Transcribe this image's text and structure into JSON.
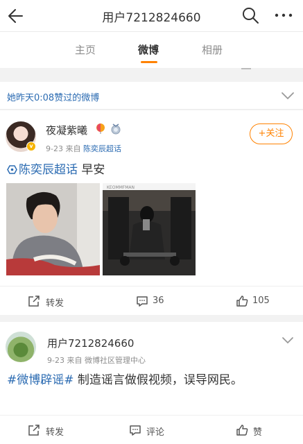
{
  "header": {
    "title": "用户7212824660"
  },
  "tabs": [
    {
      "label": "主页"
    },
    {
      "label": "微博"
    },
    {
      "label": "相册"
    }
  ],
  "likes_bar": {
    "text": "她昨天0:08赞过的微博"
  },
  "post1": {
    "author": "夜凝紫曦",
    "time": "9-23",
    "via_prefix": "来自",
    "source": "陈奕辰超话",
    "follow_label": "+关注",
    "topic": "陈奕辰超话",
    "text": "早安",
    "image2_caption": "KEOMMFMAN",
    "repost_label": "转发",
    "comment_count": "36",
    "like_count": "105"
  },
  "post2": {
    "author": "用户7212824660",
    "time": "9-23",
    "via_prefix": "来自",
    "source": "微博社区管理中心",
    "topic": "#微博辟谣#",
    "text": "制造谣言做假视频，误导网民。",
    "repost_label": "转发",
    "comment_label": "评论",
    "like_label": "赞"
  },
  "colors": {
    "accent": "#ff8200",
    "link": "#2b6bb2"
  }
}
